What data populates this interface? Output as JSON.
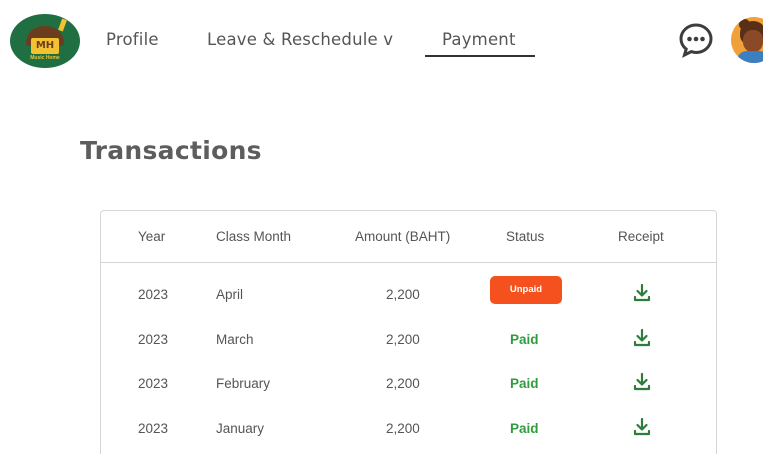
{
  "brand": {
    "logo_text": "MH",
    "tagline": "Music Home"
  },
  "nav": {
    "items": [
      {
        "label": "Profile"
      },
      {
        "label": "Leave & Reschedule v"
      },
      {
        "label": "Payment",
        "active": true
      }
    ]
  },
  "header_icons": {
    "chat": "chat-bubble-icon",
    "avatar": "user-avatar"
  },
  "page": {
    "title": "Transactions"
  },
  "table": {
    "columns": [
      "Year",
      "Class Month",
      "Amount (BAHT)",
      "Status",
      "Receipt"
    ],
    "rows": [
      {
        "year": "2023",
        "month": "April",
        "amount": "2,200",
        "status": "Unpaid"
      },
      {
        "year": "2023",
        "month": "March",
        "amount": "2,200",
        "status": "Paid"
      },
      {
        "year": "2023",
        "month": "February",
        "amount": "2,200",
        "status": "Paid"
      },
      {
        "year": "2023",
        "month": "January",
        "amount": "2,200",
        "status": "Paid"
      }
    ]
  },
  "colors": {
    "unpaid": "#f4511e",
    "paid": "#2e9c3f",
    "download_icon": "#2e7d3a",
    "brand_green": "#1f6f43"
  }
}
